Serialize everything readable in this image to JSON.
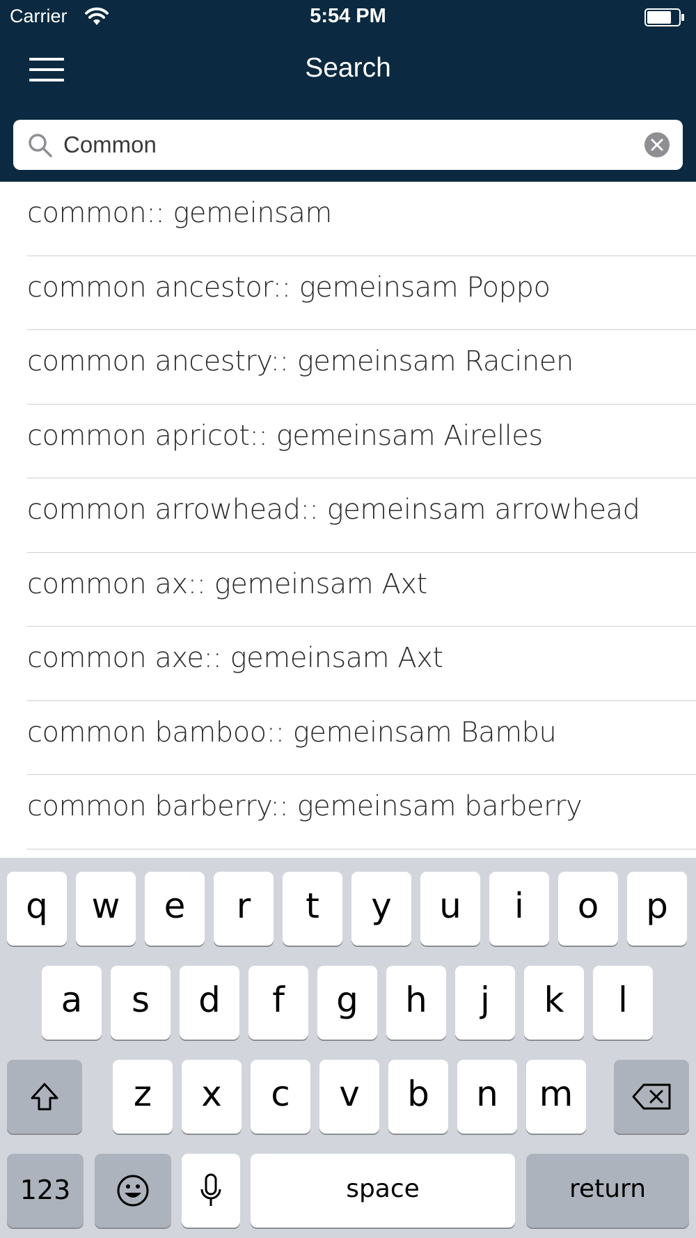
{
  "status_bar": {
    "carrier": "Carrier",
    "time": "5:54 PM"
  },
  "nav": {
    "title": "Search",
    "menu_icon": "hamburger-menu-icon"
  },
  "search": {
    "value": "Common",
    "placeholder": "",
    "icons": {
      "search": "magnifier-icon",
      "clear": "clear-x-icon"
    }
  },
  "results": [
    "common:: gemeinsam",
    "common ancestor:: gemeinsam Poppo",
    "common ancestry:: gemeinsam Racinen",
    "common apricot:: gemeinsam Airelles",
    "common arrowhead:: gemeinsam arrowhead",
    "common ax:: gemeinsam Axt",
    "common axe:: gemeinsam Axt",
    "common bamboo:: gemeinsam Bambu",
    "common barberry:: gemeinsam barberry"
  ],
  "keyboard": {
    "row1": [
      "q",
      "w",
      "e",
      "r",
      "t",
      "y",
      "u",
      "i",
      "o",
      "p"
    ],
    "row2": [
      "a",
      "s",
      "d",
      "f",
      "g",
      "h",
      "j",
      "k",
      "l"
    ],
    "row3": [
      "z",
      "x",
      "c",
      "v",
      "b",
      "n",
      "m"
    ],
    "numbers_label": "123",
    "space_label": "space",
    "return_label": "return",
    "icons": {
      "shift": "shift-icon",
      "delete": "backspace-icon",
      "emoji": "emoji-icon",
      "mic": "microphone-icon"
    }
  },
  "colors": {
    "header_bg": "#0b2a41",
    "keyboard_bg": "#d2d5dc",
    "separator": "#cfcfd4"
  }
}
